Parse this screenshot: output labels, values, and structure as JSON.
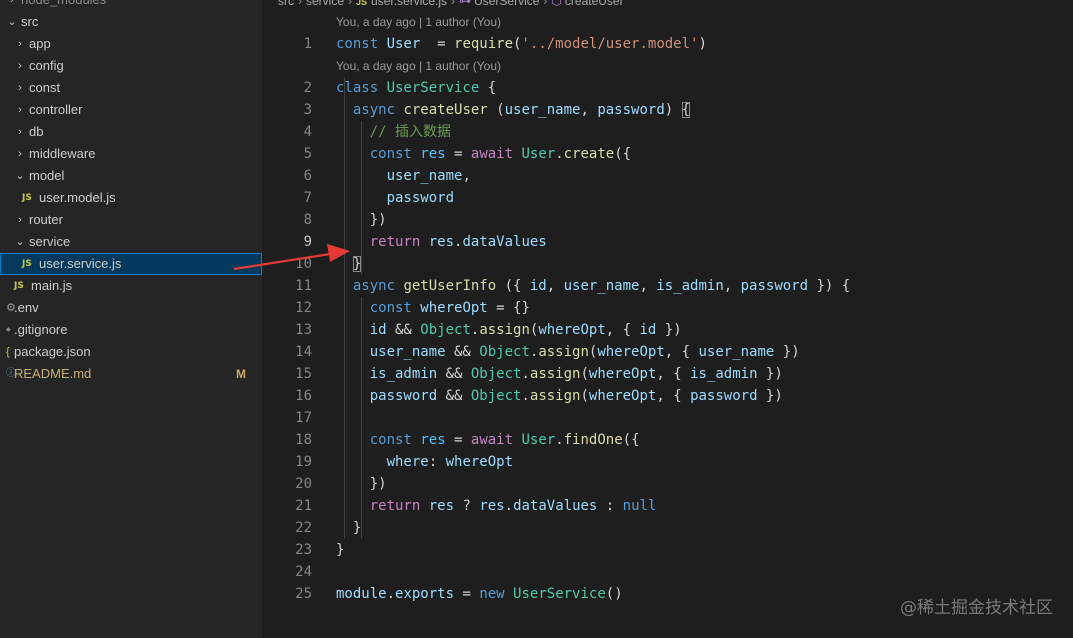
{
  "explorer": {
    "items": [
      {
        "id": "node_modules",
        "label": "node_modules",
        "kind": "folder",
        "state": "collapsed",
        "depth": 0,
        "dim": true
      },
      {
        "id": "src",
        "label": "src",
        "kind": "folder",
        "state": "expanded",
        "depth": 0
      },
      {
        "id": "app",
        "label": "app",
        "kind": "folder",
        "state": "collapsed",
        "depth": 1
      },
      {
        "id": "config",
        "label": "config",
        "kind": "folder",
        "state": "collapsed",
        "depth": 1
      },
      {
        "id": "const",
        "label": "const",
        "kind": "folder",
        "state": "collapsed",
        "depth": 1
      },
      {
        "id": "controller",
        "label": "controller",
        "kind": "folder",
        "state": "collapsed",
        "depth": 1
      },
      {
        "id": "db",
        "label": "db",
        "kind": "folder",
        "state": "collapsed",
        "depth": 1
      },
      {
        "id": "middleware",
        "label": "middleware",
        "kind": "folder",
        "state": "collapsed",
        "depth": 1
      },
      {
        "id": "model",
        "label": "model",
        "kind": "folder",
        "state": "expanded",
        "depth": 1
      },
      {
        "id": "user-model-js",
        "label": "user.model.js",
        "kind": "js",
        "depth": 2
      },
      {
        "id": "router",
        "label": "router",
        "kind": "folder",
        "state": "collapsed",
        "depth": 1
      },
      {
        "id": "service",
        "label": "service",
        "kind": "folder",
        "state": "expanded",
        "depth": 1
      },
      {
        "id": "user-service-js",
        "label": "user.service.js",
        "kind": "js",
        "depth": 2,
        "selected": true
      },
      {
        "id": "main-js",
        "label": "main.js",
        "kind": "js",
        "depth": 1
      },
      {
        "id": "env",
        "label": ".env",
        "kind": "gear",
        "depth": 0
      },
      {
        "id": "gitignore",
        "label": ".gitignore",
        "kind": "dot",
        "depth": 0
      },
      {
        "id": "package-json",
        "label": "package.json",
        "kind": "brace",
        "depth": 0
      },
      {
        "id": "readme",
        "label": "README.md",
        "kind": "info",
        "depth": 0,
        "badge": "M"
      }
    ]
  },
  "breadcrumb": {
    "src": "src",
    "service": "service",
    "file": "user.service.js",
    "file_icon": "JS",
    "class": "UserService",
    "method": "createUser"
  },
  "codelens": "You, a day ago | 1 author (You)",
  "editor": {
    "active_line": 9,
    "lines": [
      {
        "n": "1",
        "tokens": [
          [
            "k",
            "const "
          ],
          [
            "v",
            "User"
          ],
          [
            "",
            "  = "
          ],
          [
            "f",
            "require"
          ],
          [
            "",
            "("
          ],
          [
            "s",
            "'../model/user.model'"
          ],
          [
            "",
            ")"
          ]
        ]
      },
      {
        "n": "2",
        "tokens": [
          [
            "k",
            "class "
          ],
          [
            "t",
            "UserService"
          ],
          [
            "",
            " {"
          ]
        ]
      },
      {
        "n": "3",
        "tokens": [
          [
            "",
            "  "
          ],
          [
            "k",
            "async "
          ],
          [
            "f",
            "createUser"
          ],
          [
            "",
            " ("
          ],
          [
            "v",
            "user_name"
          ],
          [
            "",
            ", "
          ],
          [
            "v",
            "password"
          ],
          [
            "",
            ") "
          ],
          [
            "br",
            "{"
          ]
        ]
      },
      {
        "n": "4",
        "tokens": [
          [
            "",
            "    "
          ],
          [
            "cm",
            "// 插入数据"
          ]
        ]
      },
      {
        "n": "5",
        "tokens": [
          [
            "",
            "    "
          ],
          [
            "k",
            "const "
          ],
          [
            "d",
            "res"
          ],
          [
            "",
            " = "
          ],
          [
            "c",
            "await "
          ],
          [
            "t",
            "User"
          ],
          [
            "",
            "."
          ],
          [
            "f",
            "create"
          ],
          [
            "",
            "({"
          ]
        ]
      },
      {
        "n": "6",
        "tokens": [
          [
            "",
            "      "
          ],
          [
            "v",
            "user_name"
          ],
          [
            "",
            ","
          ]
        ]
      },
      {
        "n": "7",
        "tokens": [
          [
            "",
            "      "
          ],
          [
            "v",
            "password"
          ]
        ]
      },
      {
        "n": "8",
        "tokens": [
          [
            "",
            "    })"
          ]
        ]
      },
      {
        "n": "9",
        "tokens": [
          [
            "",
            "    "
          ],
          [
            "c",
            "return "
          ],
          [
            "v",
            "res"
          ],
          [
            "",
            "."
          ],
          [
            "v",
            "dataValues"
          ]
        ]
      },
      {
        "n": "10",
        "tokens": [
          [
            "",
            "  "
          ],
          [
            "br",
            "}"
          ]
        ]
      },
      {
        "n": "11",
        "tokens": [
          [
            "",
            "  "
          ],
          [
            "k",
            "async "
          ],
          [
            "f",
            "getUserInfo"
          ],
          [
            "",
            " ({ "
          ],
          [
            "v",
            "id"
          ],
          [
            "",
            ", "
          ],
          [
            "v",
            "user_name"
          ],
          [
            "",
            ", "
          ],
          [
            "v",
            "is_admin"
          ],
          [
            "",
            ", "
          ],
          [
            "v",
            "password"
          ],
          [
            "",
            " }) {"
          ]
        ]
      },
      {
        "n": "12",
        "tokens": [
          [
            "",
            "    "
          ],
          [
            "k",
            "const "
          ],
          [
            "v",
            "whereOpt"
          ],
          [
            "",
            " = {}"
          ]
        ]
      },
      {
        "n": "13",
        "tokens": [
          [
            "",
            "    "
          ],
          [
            "v",
            "id"
          ],
          [
            "",
            " && "
          ],
          [
            "t",
            "Object"
          ],
          [
            "",
            "."
          ],
          [
            "f",
            "assign"
          ],
          [
            "",
            "("
          ],
          [
            "v",
            "whereOpt"
          ],
          [
            "",
            ", { "
          ],
          [
            "v",
            "id"
          ],
          [
            "",
            " })"
          ]
        ]
      },
      {
        "n": "14",
        "tokens": [
          [
            "",
            "    "
          ],
          [
            "v",
            "user_name"
          ],
          [
            "",
            " && "
          ],
          [
            "t",
            "Object"
          ],
          [
            "",
            "."
          ],
          [
            "f",
            "assign"
          ],
          [
            "",
            "("
          ],
          [
            "v",
            "whereOpt"
          ],
          [
            "",
            ", { "
          ],
          [
            "v",
            "user_name"
          ],
          [
            "",
            " })"
          ]
        ]
      },
      {
        "n": "15",
        "tokens": [
          [
            "",
            "    "
          ],
          [
            "v",
            "is_admin"
          ],
          [
            "",
            " && "
          ],
          [
            "t",
            "Object"
          ],
          [
            "",
            "."
          ],
          [
            "f",
            "assign"
          ],
          [
            "",
            "("
          ],
          [
            "v",
            "whereOpt"
          ],
          [
            "",
            ", { "
          ],
          [
            "v",
            "is_admin"
          ],
          [
            "",
            " })"
          ]
        ]
      },
      {
        "n": "16",
        "tokens": [
          [
            "",
            "    "
          ],
          [
            "v",
            "password"
          ],
          [
            "",
            " && "
          ],
          [
            "t",
            "Object"
          ],
          [
            "",
            "."
          ],
          [
            "f",
            "assign"
          ],
          [
            "",
            "("
          ],
          [
            "v",
            "whereOpt"
          ],
          [
            "",
            ", { "
          ],
          [
            "v",
            "password"
          ],
          [
            "",
            " })"
          ]
        ]
      },
      {
        "n": "17",
        "tokens": []
      },
      {
        "n": "18",
        "tokens": [
          [
            "",
            "    "
          ],
          [
            "k",
            "const "
          ],
          [
            "d",
            "res"
          ],
          [
            "",
            " = "
          ],
          [
            "c",
            "await "
          ],
          [
            "t",
            "User"
          ],
          [
            "",
            "."
          ],
          [
            "f",
            "findOne"
          ],
          [
            "",
            "({"
          ]
        ]
      },
      {
        "n": "19",
        "tokens": [
          [
            "",
            "      "
          ],
          [
            "v",
            "where"
          ],
          [
            "",
            ": "
          ],
          [
            "v",
            "whereOpt"
          ]
        ]
      },
      {
        "n": "20",
        "tokens": [
          [
            "",
            "    })"
          ]
        ]
      },
      {
        "n": "21",
        "tokens": [
          [
            "",
            "    "
          ],
          [
            "c",
            "return "
          ],
          [
            "v",
            "res"
          ],
          [
            "",
            " ? "
          ],
          [
            "v",
            "res"
          ],
          [
            "",
            "."
          ],
          [
            "v",
            "dataValues"
          ],
          [
            "",
            " : "
          ],
          [
            "k",
            "null"
          ]
        ]
      },
      {
        "n": "22",
        "tokens": [
          [
            "",
            "  }"
          ]
        ]
      },
      {
        "n": "23",
        "tokens": [
          [
            "",
            "}"
          ]
        ]
      },
      {
        "n": "24",
        "tokens": []
      },
      {
        "n": "25",
        "tokens": [
          [
            "v",
            "module"
          ],
          [
            "",
            "."
          ],
          [
            "v",
            "exports"
          ],
          [
            "",
            " = "
          ],
          [
            "k",
            "new "
          ],
          [
            "t",
            "UserService"
          ],
          [
            "",
            "()"
          ]
        ]
      }
    ]
  },
  "watermark": "@稀土掘金技术社区",
  "colors": {
    "arrow": "#e53935",
    "selection": "#04395e",
    "selection_border": "#007fd4"
  }
}
